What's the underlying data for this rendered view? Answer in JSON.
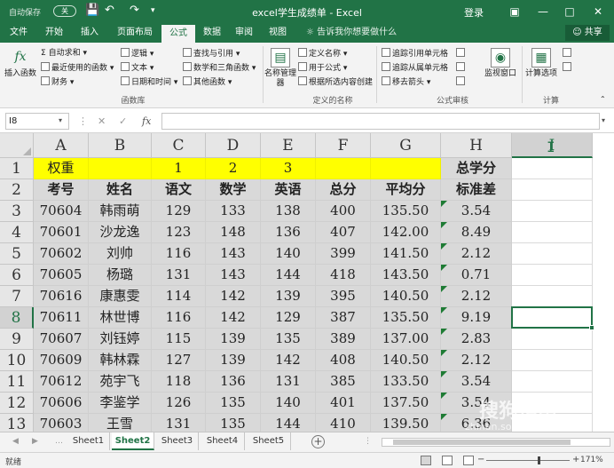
{
  "titlebar": {
    "autosave": "自动保存",
    "autosave_state": "关",
    "title": "excel学生成绩单 - Excel",
    "login": "登录"
  },
  "ribbon_tabs": [
    "文件",
    "开始",
    "插入",
    "页面布局",
    "公式",
    "数据",
    "审阅",
    "视图"
  ],
  "active_tab": "公式",
  "tell_me": "告诉我你想要做什么",
  "share": "共享",
  "ribbon": {
    "insert_function": "插入函数",
    "autosum": "自动求和",
    "recent": "最近使用的函数",
    "financial": "财务",
    "logical": "逻辑",
    "text": "文本",
    "datetime": "日期和时间",
    "lookup": "查找与引用",
    "math": "数学和三角函数",
    "more": "其他函数",
    "group_library": "函数库",
    "name_manager": "名称管理器",
    "define_name": "定义名称",
    "use_in_formula": "用于公式",
    "create_from_selection": "根据所选内容创建",
    "group_names": "定义的名称",
    "trace_precedents": "追踪引用单元格",
    "trace_dependents": "追踪从属单元格",
    "remove_arrows": "移去箭头",
    "watch_window": "监视窗口",
    "group_audit": "公式审核",
    "calc_options": "计算选项",
    "group_calc": "计算"
  },
  "formula_bar": {
    "name_box": "I8",
    "fx": "fx"
  },
  "columns": [
    "A",
    "B",
    "C",
    "D",
    "E",
    "F",
    "G",
    "H",
    "I"
  ],
  "row_numbers": [
    "1",
    "2",
    "3",
    "4",
    "5",
    "6",
    "7",
    "8",
    "9",
    "10",
    "11",
    "12",
    "13"
  ],
  "row1": {
    "a": "权重",
    "c": "1",
    "d": "2",
    "e": "3",
    "h": "总学分"
  },
  "headers": [
    "考号",
    "姓名",
    "语文",
    "数学",
    "英语",
    "总分",
    "平均分",
    "标准差"
  ],
  "rows": [
    [
      "70604",
      "韩雨萌",
      "129",
      "133",
      "138",
      "400",
      "135.50",
      "3.54"
    ],
    [
      "70601",
      "沙龙逸",
      "123",
      "148",
      "136",
      "407",
      "142.00",
      "8.49"
    ],
    [
      "70602",
      "刘帅",
      "116",
      "143",
      "140",
      "399",
      "141.50",
      "2.12"
    ],
    [
      "70605",
      "杨璐",
      "131",
      "143",
      "144",
      "418",
      "143.50",
      "0.71"
    ],
    [
      "70616",
      "康惠雯",
      "114",
      "142",
      "139",
      "395",
      "140.50",
      "2.12"
    ],
    [
      "70611",
      "林世博",
      "116",
      "142",
      "129",
      "387",
      "135.50",
      "9.19"
    ],
    [
      "70607",
      "刘钰婷",
      "115",
      "139",
      "135",
      "389",
      "137.00",
      "2.83"
    ],
    [
      "70609",
      "韩林霖",
      "127",
      "139",
      "142",
      "408",
      "140.50",
      "2.12"
    ],
    [
      "70612",
      "苑宇飞",
      "118",
      "136",
      "131",
      "385",
      "133.50",
      "3.54"
    ],
    [
      "70606",
      "李鉴学",
      "126",
      "135",
      "140",
      "401",
      "137.50",
      "3.54"
    ],
    [
      "70603",
      "王雪",
      "131",
      "135",
      "144",
      "410",
      "139.50",
      "6.36"
    ]
  ],
  "sheets": [
    "Sheet1",
    "Sheet2",
    "Sheet3",
    "Sheet4",
    "Sheet5"
  ],
  "active_sheet": "Sheet2",
  "status": {
    "ready": "就绪",
    "zoom": "171%"
  },
  "watermark": {
    "main": "搜狗指南",
    "sub": "zhinan.sogou.com"
  },
  "colors": {
    "excel_green": "#217346",
    "yellow": "#ffff00",
    "grey": "#d9d9d9"
  }
}
